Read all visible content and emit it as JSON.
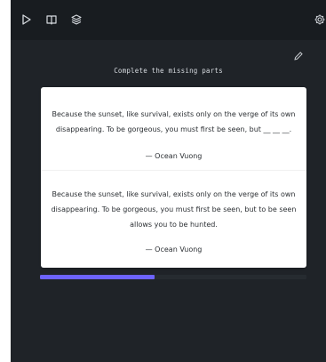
{
  "toolbar": {
    "icons": [
      "play-icon",
      "book-icon",
      "layers-icon",
      "gear-icon"
    ]
  },
  "prompt": {
    "heading": "Complete the missing parts"
  },
  "card": {
    "question_text": "Because the sunset, like survival, exists only on the verge of its own disappearing. To be gorgeous, you must first be seen, but __ __ __.",
    "question_author": "— Ocean Vuong",
    "answer_text": "Because the sunset, like survival, exists only on the verge of its own disappearing. To be gorgeous, you must first be seen, but to be seen allows you to be hunted.",
    "answer_author": "— Ocean Vuong"
  },
  "progress": {
    "fraction": 0.43
  },
  "colors": {
    "accent": "#6c63ff",
    "background": "#1f2328",
    "toolbar": "#181c20"
  }
}
